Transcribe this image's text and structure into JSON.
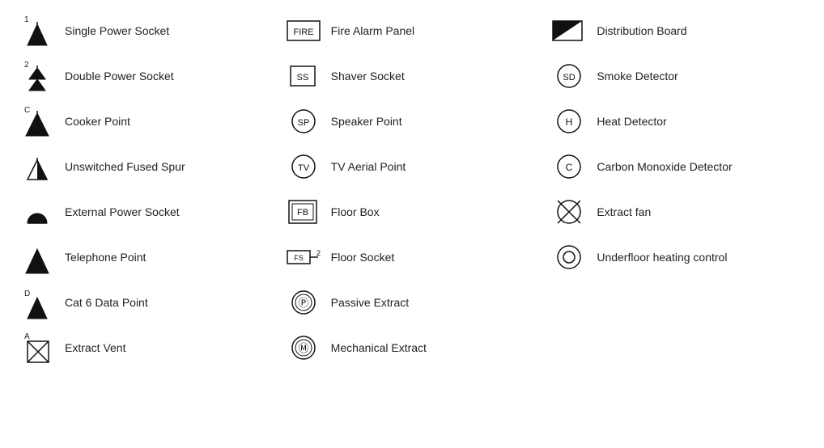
{
  "items": {
    "col1": [
      {
        "id": "single-power-socket",
        "label": "Single Power Socket",
        "symbol": "single-power"
      },
      {
        "id": "double-power-socket",
        "label": "Double Power Socket",
        "symbol": "double-power"
      },
      {
        "id": "cooker-point",
        "label": "Cooker Point",
        "symbol": "cooker"
      },
      {
        "id": "unswitched-fused-spur",
        "label": "Unswitched Fused Spur",
        "symbol": "unswitched-fused"
      },
      {
        "id": "external-power-socket",
        "label": "External Power Socket",
        "symbol": "external-power"
      },
      {
        "id": "telephone-point",
        "label": "Telephone Point",
        "symbol": "telephone"
      },
      {
        "id": "cat6-data-point",
        "label": "Cat 6 Data Point",
        "symbol": "cat6"
      },
      {
        "id": "extract-vent",
        "label": "Extract Vent",
        "symbol": "extract-vent"
      }
    ],
    "col2": [
      {
        "id": "fire-alarm-panel",
        "label": "Fire Alarm Panel",
        "symbol": "fire-alarm"
      },
      {
        "id": "shaver-socket",
        "label": "Shaver Socket",
        "symbol": "shaver"
      },
      {
        "id": "speaker-point",
        "label": "Speaker Point",
        "symbol": "speaker"
      },
      {
        "id": "tv-aerial-point",
        "label": "TV Aerial Point",
        "symbol": "tv-aerial"
      },
      {
        "id": "floor-box",
        "label": "Floor Box",
        "symbol": "floor-box"
      },
      {
        "id": "floor-socket",
        "label": "Floor Socket",
        "symbol": "floor-socket"
      },
      {
        "id": "passive-extract",
        "label": "Passive Extract",
        "symbol": "passive-extract"
      },
      {
        "id": "mechanical-extract",
        "label": "Mechanical Extract",
        "symbol": "mechanical-extract"
      }
    ],
    "col3": [
      {
        "id": "distribution-board",
        "label": "Distribution Board",
        "symbol": "distribution-board"
      },
      {
        "id": "smoke-detector",
        "label": "Smoke Detector",
        "symbol": "smoke-detector"
      },
      {
        "id": "heat-detector",
        "label": "Heat Detector",
        "symbol": "heat-detector"
      },
      {
        "id": "carbon-monoxide-detector",
        "label": "Carbon Monoxide Detector",
        "symbol": "co-detector"
      },
      {
        "id": "extract-fan",
        "label": "Extract fan",
        "symbol": "extract-fan"
      },
      {
        "id": "underfloor-heating-control",
        "label": "Underfloor heating control",
        "symbol": "underfloor-heat"
      }
    ]
  }
}
